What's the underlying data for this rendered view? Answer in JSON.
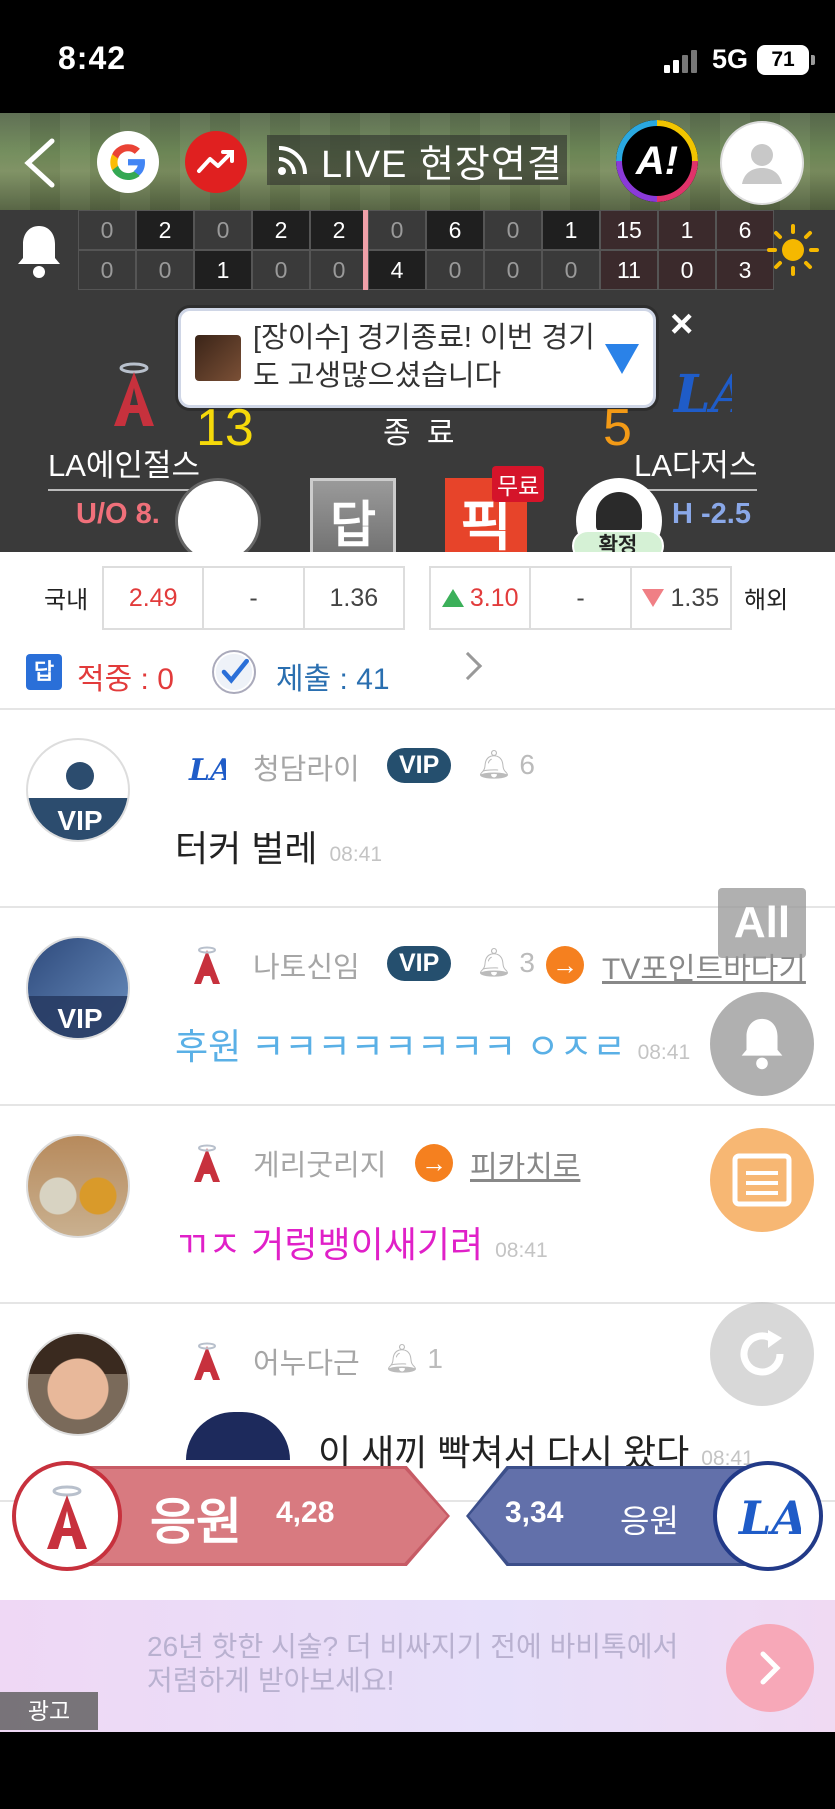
{
  "status_bar": {
    "time": "8:42",
    "network": "5G",
    "battery": "71"
  },
  "nav": {
    "live_label": "LIVE 현장연결",
    "a_label": "A!"
  },
  "scoreboard": {
    "row1": [
      "0",
      "2",
      "0",
      "2",
      "2",
      "0",
      "6",
      "0",
      "1",
      "15",
      "1",
      "6"
    ],
    "row2": [
      "0",
      "0",
      "1",
      "0",
      "0",
      "4",
      "0",
      "0",
      "0",
      "11",
      "0",
      "3"
    ]
  },
  "notice": {
    "text": "[장이수] 경기종료!  이번 경기도 고생많으셨습니다",
    "close": "×"
  },
  "match": {
    "home_team": "LA에인절스",
    "away_team": "LA다저스",
    "home_score": "13",
    "away_score": "5",
    "status": "종 료",
    "ou": "U/O 8.",
    "handicap": "H -2.5",
    "dap_label": "답",
    "pick_label": "픽",
    "free_label": "무료",
    "confirmed_label": "확정"
  },
  "odds": {
    "domestic_label": "국내",
    "overseas_label": "해외",
    "domestic": [
      "2.49",
      "-",
      "1.36"
    ],
    "overseas": [
      "3.10",
      "-",
      "1.35"
    ]
  },
  "stats": {
    "hit_label": "적중 : 0",
    "submit_label": "제출 : 41",
    "hit_icon": "답"
  },
  "comments": [
    {
      "name": "청담라이",
      "vip": "VIP",
      "bells": "6",
      "text": "터커 벌레",
      "time": "08:41",
      "avatar_label": "VIP"
    },
    {
      "name": "나토신임",
      "vip": "VIP",
      "bells": "3",
      "link": "TV포인트바다기",
      "text": "후원 ㅋㅋㅋㅋㅋㅋㅋㅋ ㅇㅈㄹ",
      "time": "08:41",
      "avatar_label": "VIP"
    },
    {
      "name": "게리굿리지",
      "link": "피카치로",
      "text": "ㄲㅈ 거렁뱅이새기려",
      "time": "08:41"
    },
    {
      "name": "어누다근",
      "bells": "1",
      "text": "이 새끼 빡쳐서 다시 왔다",
      "time": "08:41"
    }
  ],
  "floating": {
    "all_label": "All"
  },
  "cheer": {
    "home_label": "응원",
    "home_count": "4,28",
    "away_count": "3,34",
    "away_label": "응원"
  },
  "ad": {
    "text": "26년 핫한 시술? 더 비싸지기 전에 바비톡에서 저렴하게 받아보세요!",
    "tag": "광고"
  },
  "colors": {
    "home": "#c7313d",
    "away": "#223a88",
    "vip": "#254f6e",
    "accent_orange": "#f5801f"
  }
}
